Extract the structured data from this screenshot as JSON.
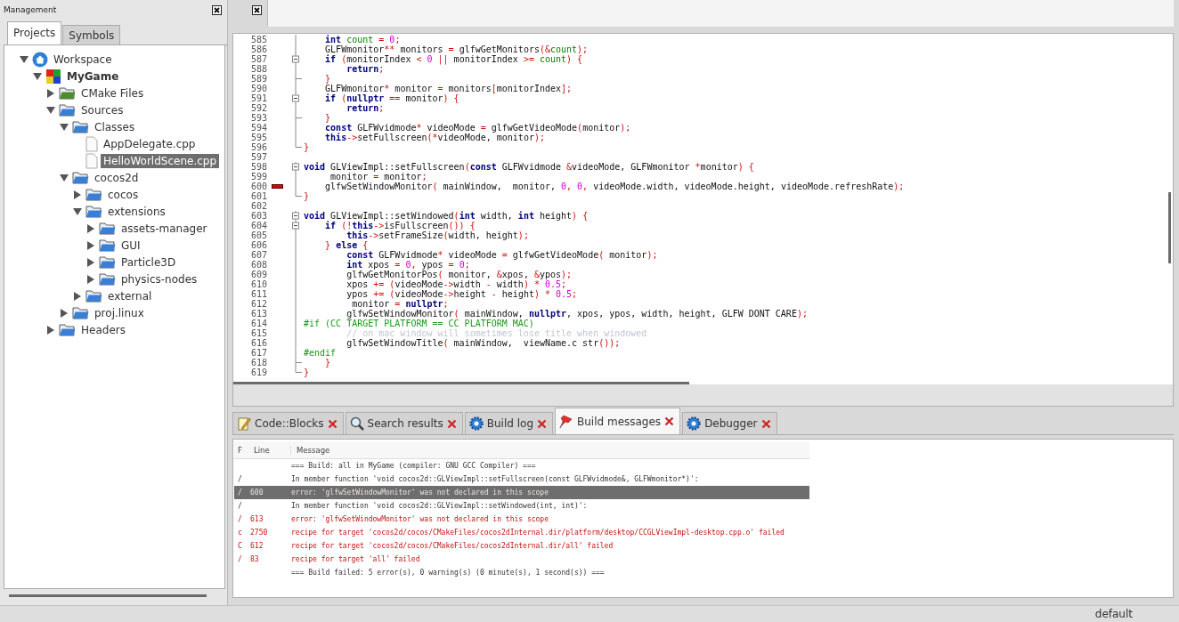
{
  "management": {
    "title": "Management",
    "tabs": [
      {
        "label": "Projects",
        "selected": true
      },
      {
        "label": "Symbols",
        "selected": false
      }
    ],
    "tree": [
      {
        "label": "Workspace",
        "kind": "workspace",
        "expanded": true,
        "selected": false,
        "children": [
          {
            "label": "MyGame",
            "kind": "project",
            "expanded": true,
            "selected": false,
            "children": [
              {
                "label": "CMake Files",
                "kind": "folder",
                "color": "#4e8a2e",
                "expanded": false,
                "selected": false
              },
              {
                "label": "Sources",
                "kind": "folder",
                "color": "#3a7fd6",
                "expanded": true,
                "selected": false,
                "children": [
                  {
                    "label": "Classes",
                    "kind": "folder",
                    "color": "#3a7fd6",
                    "expanded": true,
                    "selected": false,
                    "children": [
                      {
                        "label": "AppDelegate.cpp",
                        "kind": "file",
                        "selected": false
                      },
                      {
                        "label": "HelloWorldScene.cpp",
                        "kind": "file",
                        "selected": true
                      }
                    ]
                  },
                  {
                    "label": "cocos2d",
                    "kind": "folder",
                    "color": "#3a7fd6",
                    "expanded": true,
                    "selected": false,
                    "children": [
                      {
                        "label": "cocos",
                        "kind": "folder",
                        "color": "#3a7fd6",
                        "expanded": false,
                        "selected": false
                      },
                      {
                        "label": "extensions",
                        "kind": "folder",
                        "color": "#3a7fd6",
                        "expanded": true,
                        "selected": false,
                        "children": [
                          {
                            "label": "assets-manager",
                            "kind": "folder",
                            "color": "#3a7fd6",
                            "expanded": false,
                            "selected": false
                          },
                          {
                            "label": "GUI",
                            "kind": "folder",
                            "color": "#3a7fd6",
                            "expanded": false,
                            "selected": false
                          },
                          {
                            "label": "Particle3D",
                            "kind": "folder",
                            "color": "#3a7fd6",
                            "expanded": false,
                            "selected": false
                          },
                          {
                            "label": "physics-nodes",
                            "kind": "folder",
                            "color": "#3a7fd6",
                            "expanded": false,
                            "selected": false
                          }
                        ]
                      },
                      {
                        "label": "external",
                        "kind": "folder",
                        "color": "#3a7fd6",
                        "expanded": false,
                        "selected": false
                      }
                    ]
                  },
                  {
                    "label": "proj.linux",
                    "kind": "folder",
                    "color": "#3a7fd6",
                    "expanded": false,
                    "selected": false
                  }
                ]
              },
              {
                "label": "Headers",
                "kind": "folder",
                "color": "#3a7fd6",
                "expanded": false,
                "selected": false
              }
            ]
          }
        ]
      }
    ]
  },
  "editor": {
    "lines": [
      {
        "number": "585",
        "kind": "line",
        "error": false,
        "tokens": [
          {
            "kind": "kw",
            "text": "    int"
          },
          {
            "kind": "var",
            "text": " count"
          },
          {
            "kind": "op",
            "text": " ="
          },
          {
            "kind": "num",
            "text": " 0"
          },
          {
            "kind": "op",
            "text": ";"
          }
        ]
      },
      {
        "number": "586",
        "kind": "line",
        "error": false,
        "tokens": [
          {
            "kind": "tx",
            "text": "    GLFWmonitor"
          },
          {
            "kind": "op",
            "text": "**"
          },
          {
            "kind": "tx",
            "text": " monitors "
          },
          {
            "kind": "op",
            "text": "="
          },
          {
            "kind": "tx",
            "text": " glfwGetMonitors"
          },
          {
            "kind": "op",
            "text": "(&"
          },
          {
            "kind": "var",
            "text": "count"
          },
          {
            "kind": "op",
            "text": ");"
          }
        ]
      },
      {
        "number": "587",
        "kind": "open",
        "error": false,
        "tokens": [
          {
            "kind": "kw",
            "text": "    if"
          },
          {
            "kind": "op",
            "text": " ("
          },
          {
            "kind": "tx",
            "text": "monitorIndex "
          },
          {
            "kind": "op",
            "text": "<"
          },
          {
            "kind": "num",
            "text": " 0"
          },
          {
            "kind": "op",
            "text": " ||"
          },
          {
            "kind": "tx",
            "text": " monitorIndex "
          },
          {
            "kind": "op",
            "text": ">="
          },
          {
            "kind": "var",
            "text": " count"
          },
          {
            "kind": "op",
            "text": ") {"
          }
        ]
      },
      {
        "number": "588",
        "kind": "line",
        "error": false,
        "tokens": [
          {
            "kind": "kw",
            "text": "        return"
          },
          {
            "kind": "op",
            "text": ";"
          }
        ]
      },
      {
        "number": "589",
        "kind": "branch",
        "error": false,
        "tokens": [
          {
            "kind": "op",
            "text": "    }"
          }
        ]
      },
      {
        "number": "590",
        "kind": "line",
        "error": false,
        "tokens": [
          {
            "kind": "tx",
            "text": "    GLFWmonitor"
          },
          {
            "kind": "op",
            "text": "*"
          },
          {
            "kind": "tx",
            "text": " monitor "
          },
          {
            "kind": "op",
            "text": "="
          },
          {
            "kind": "tx",
            "text": " monitors"
          },
          {
            "kind": "op",
            "text": "["
          },
          {
            "kind": "tx",
            "text": "monitorIndex"
          },
          {
            "kind": "op",
            "text": "];"
          }
        ]
      },
      {
        "number": "591",
        "kind": "open",
        "error": false,
        "tokens": [
          {
            "kind": "kw",
            "text": "    if"
          },
          {
            "kind": "op",
            "text": " ("
          },
          {
            "kind": "kw",
            "text": "nullptr"
          },
          {
            "kind": "op",
            "text": " =="
          },
          {
            "kind": "tx",
            "text": " monitor"
          },
          {
            "kind": "op",
            "text": ") {"
          }
        ]
      },
      {
        "number": "592",
        "kind": "line",
        "error": false,
        "tokens": [
          {
            "kind": "kw",
            "text": "        return"
          },
          {
            "kind": "op",
            "text": ";"
          }
        ]
      },
      {
        "number": "593",
        "kind": "branch",
        "error": false,
        "tokens": [
          {
            "kind": "op",
            "text": "    }"
          }
        ]
      },
      {
        "number": "594",
        "kind": "line",
        "error": false,
        "tokens": [
          {
            "kind": "kw",
            "text": "    const"
          },
          {
            "kind": "tx",
            "text": " GLFWvidmode"
          },
          {
            "kind": "op",
            "text": "*"
          },
          {
            "kind": "tx",
            "text": " videoMode "
          },
          {
            "kind": "op",
            "text": "="
          },
          {
            "kind": "tx",
            "text": " glfwGetVideoMode"
          },
          {
            "kind": "op",
            "text": "("
          },
          {
            "kind": "tx",
            "text": "monitor"
          },
          {
            "kind": "op",
            "text": ");"
          }
        ]
      },
      {
        "number": "595",
        "kind": "line",
        "error": false,
        "tokens": [
          {
            "kind": "kw",
            "text": "    this"
          },
          {
            "kind": "op",
            "text": "->"
          },
          {
            "kind": "tx",
            "text": "setFullscreen"
          },
          {
            "kind": "op",
            "text": "(*"
          },
          {
            "kind": "tx",
            "text": "videoMode, monitor"
          },
          {
            "kind": "op",
            "text": ");"
          }
        ]
      },
      {
        "number": "596",
        "kind": "end",
        "error": false,
        "tokens": [
          {
            "kind": "op",
            "text": "}"
          }
        ]
      },
      {
        "number": "597",
        "kind": "plain",
        "error": false
      },
      {
        "number": "598",
        "kind": "open",
        "error": false,
        "tokens": [
          {
            "kind": "kw",
            "text": "void"
          },
          {
            "kind": "tx",
            "text": " GLViewImpl::setFullscreen"
          },
          {
            "kind": "op",
            "text": "("
          },
          {
            "kind": "kw",
            "text": "const"
          },
          {
            "kind": "tx",
            "text": " GLFWvidmode "
          },
          {
            "kind": "op",
            "text": "&"
          },
          {
            "kind": "tx",
            "text": "videoMode, GLFWmonitor "
          },
          {
            "kind": "op",
            "text": "*"
          },
          {
            "kind": "tx",
            "text": "monitor"
          },
          {
            "kind": "op",
            "text": ") {"
          }
        ]
      },
      {
        "number": "599",
        "kind": "line",
        "error": false,
        "tokens": [
          {
            "kind": "tx",
            "text": "     monitor "
          },
          {
            "kind": "op",
            "text": "="
          },
          {
            "kind": "tx",
            "text": " monitor"
          },
          {
            "kind": "op",
            "text": ";"
          }
        ]
      },
      {
        "number": "600",
        "kind": "line",
        "error": true,
        "tokens": [
          {
            "kind": "tx",
            "text": "    glfwSetWindowMonitor"
          },
          {
            "kind": "op",
            "text": "("
          },
          {
            "kind": "tx",
            "text": " mainWindow,  monitor,"
          },
          {
            "kind": "num",
            "text": " 0"
          },
          {
            "kind": "op",
            "text": ","
          },
          {
            "kind": "num",
            "text": " 0"
          },
          {
            "kind": "op",
            "text": ","
          },
          {
            "kind": "tx",
            "text": " videoMode.width, videoMode.height, videoMode.refreshRate"
          },
          {
            "kind": "op",
            "text": ");"
          }
        ]
      },
      {
        "number": "601",
        "kind": "end",
        "error": false,
        "tokens": [
          {
            "kind": "op",
            "text": "}"
          }
        ]
      },
      {
        "number": "602",
        "kind": "plain",
        "error": false
      },
      {
        "number": "603",
        "kind": "open",
        "error": false,
        "tokens": [
          {
            "kind": "kw",
            "text": "void"
          },
          {
            "kind": "tx",
            "text": " GLViewImpl::setWindowed"
          },
          {
            "kind": "op",
            "text": "("
          },
          {
            "kind": "kw",
            "text": "int"
          },
          {
            "kind": "tx",
            "text": " width,"
          },
          {
            "kind": "kw",
            "text": " int"
          },
          {
            "kind": "tx",
            "text": " height"
          },
          {
            "kind": "op",
            "text": ") {"
          }
        ]
      },
      {
        "number": "604",
        "kind": "open",
        "error": false,
        "tokens": [
          {
            "kind": "kw",
            "text": "    if"
          },
          {
            "kind": "op",
            "text": " (!"
          },
          {
            "kind": "kw",
            "text": "this"
          },
          {
            "kind": "op",
            "text": "->"
          },
          {
            "kind": "tx",
            "text": "isFullscreen"
          },
          {
            "kind": "op",
            "text": "()) {"
          }
        ]
      },
      {
        "number": "605",
        "kind": "line",
        "error": false,
        "tokens": [
          {
            "kind": "kw",
            "text": "        this"
          },
          {
            "kind": "op",
            "text": "->"
          },
          {
            "kind": "tx",
            "text": "setFrameSize"
          },
          {
            "kind": "op",
            "text": "("
          },
          {
            "kind": "tx",
            "text": "width, height"
          },
          {
            "kind": "op",
            "text": ");"
          }
        ]
      },
      {
        "number": "606",
        "kind": "line",
        "error": false,
        "tokens": [
          {
            "kind": "op",
            "text": "    }"
          },
          {
            "kind": "kw",
            "text": " else"
          },
          {
            "kind": "op",
            "text": " {"
          }
        ]
      },
      {
        "number": "607",
        "kind": "line",
        "error": false,
        "tokens": [
          {
            "kind": "kw",
            "text": "        const"
          },
          {
            "kind": "tx",
            "text": " GLFWvidmode"
          },
          {
            "kind": "op",
            "text": "*"
          },
          {
            "kind": "tx",
            "text": " videoMode "
          },
          {
            "kind": "op",
            "text": "="
          },
          {
            "kind": "tx",
            "text": " glfwGetVideoMode"
          },
          {
            "kind": "op",
            "text": "("
          },
          {
            "kind": "tx",
            "text": " monitor"
          },
          {
            "kind": "op",
            "text": ");"
          }
        ]
      },
      {
        "number": "608",
        "kind": "line",
        "error": false,
        "tokens": [
          {
            "kind": "kw",
            "text": "        int"
          },
          {
            "kind": "tx",
            "text": " xpos "
          },
          {
            "kind": "op",
            "text": "="
          },
          {
            "kind": "num",
            "text": " 0"
          },
          {
            "kind": "op",
            "text": ","
          },
          {
            "kind": "tx",
            "text": " ypos "
          },
          {
            "kind": "op",
            "text": "="
          },
          {
            "kind": "num",
            "text": " 0"
          },
          {
            "kind": "op",
            "text": ";"
          }
        ]
      },
      {
        "number": "609",
        "kind": "line",
        "error": false,
        "tokens": [
          {
            "kind": "tx",
            "text": "        glfwGetMonitorPos"
          },
          {
            "kind": "op",
            "text": "("
          },
          {
            "kind": "tx",
            "text": " monitor, "
          },
          {
            "kind": "op",
            "text": "&"
          },
          {
            "kind": "tx",
            "text": "xpos, "
          },
          {
            "kind": "op",
            "text": "&"
          },
          {
            "kind": "tx",
            "text": "ypos"
          },
          {
            "kind": "op",
            "text": ");"
          }
        ]
      },
      {
        "number": "610",
        "kind": "line",
        "error": false,
        "tokens": [
          {
            "kind": "tx",
            "text": "        xpos "
          },
          {
            "kind": "op",
            "text": "+= ("
          },
          {
            "kind": "tx",
            "text": "videoMode"
          },
          {
            "kind": "op",
            "text": "->"
          },
          {
            "kind": "tx",
            "text": "width "
          },
          {
            "kind": "op",
            "text": "-"
          },
          {
            "kind": "tx",
            "text": " width"
          },
          {
            "kind": "op",
            "text": ") *"
          },
          {
            "kind": "num",
            "text": " 0.5"
          },
          {
            "kind": "op",
            "text": ";"
          }
        ]
      },
      {
        "number": "611",
        "kind": "line",
        "error": false,
        "tokens": [
          {
            "kind": "tx",
            "text": "        ypos "
          },
          {
            "kind": "op",
            "text": "+= ("
          },
          {
            "kind": "tx",
            "text": "videoMode"
          },
          {
            "kind": "op",
            "text": "->"
          },
          {
            "kind": "tx",
            "text": "height "
          },
          {
            "kind": "op",
            "text": "-"
          },
          {
            "kind": "tx",
            "text": " height"
          },
          {
            "kind": "op",
            "text": ") *"
          },
          {
            "kind": "num",
            "text": " 0.5"
          },
          {
            "kind": "op",
            "text": ";"
          }
        ]
      },
      {
        "number": "612",
        "kind": "line",
        "error": false,
        "tokens": [
          {
            "kind": "tx",
            "text": "         monitor "
          },
          {
            "kind": "op",
            "text": "="
          },
          {
            "kind": "kw",
            "text": " nullptr"
          },
          {
            "kind": "op",
            "text": ";"
          }
        ]
      },
      {
        "number": "613",
        "kind": "line",
        "error": false,
        "tokens": [
          {
            "kind": "tx",
            "text": "        glfwSetWindowMonitor"
          },
          {
            "kind": "op",
            "text": "("
          },
          {
            "kind": "tx",
            "text": " mainWindow,"
          },
          {
            "kind": "kw",
            "text": " nullptr"
          },
          {
            "kind": "tx",
            "text": ", xpos, ypos, width, height, GLFW DONT CARE"
          },
          {
            "kind": "op",
            "text": ");"
          }
        ]
      },
      {
        "number": "614",
        "kind": "line",
        "error": false,
        "tokens": [
          {
            "kind": "pp",
            "text": "#if (CC TARGET PLATFORM == CC PLATFORM MAC)"
          }
        ]
      },
      {
        "number": "615",
        "kind": "line",
        "error": false,
        "tokens": [
          {
            "kind": "cm",
            "text": "        // on mac window will sometimes lose title when windowed"
          }
        ]
      },
      {
        "number": "616",
        "kind": "line",
        "error": false,
        "tokens": [
          {
            "kind": "tx",
            "text": "        glfwSetWindowTitle"
          },
          {
            "kind": "op",
            "text": "("
          },
          {
            "kind": "tx",
            "text": " mainWindow,  viewName.c str"
          },
          {
            "kind": "op",
            "text": "());"
          }
        ]
      },
      {
        "number": "617",
        "kind": "line",
        "error": false,
        "tokens": [
          {
            "kind": "pp",
            "text": "#endif"
          }
        ]
      },
      {
        "number": "618",
        "kind": "branch",
        "error": false,
        "tokens": [
          {
            "kind": "op",
            "text": "    }"
          }
        ]
      },
      {
        "number": "619",
        "kind": "end",
        "error": false,
        "tokens": [
          {
            "kind": "op",
            "text": "}"
          }
        ]
      }
    ]
  },
  "log_tabs": [
    {
      "label": "Code::Blocks",
      "kind": "note",
      "selected": false
    },
    {
      "label": "Search results",
      "kind": "search",
      "selected": false
    },
    {
      "label": "Build log",
      "kind": "gear",
      "selected": false
    },
    {
      "label": "Build messages",
      "kind": "pin",
      "selected": true
    },
    {
      "label": "Debugger",
      "kind": "gear",
      "selected": false
    }
  ],
  "build_messages": {
    "columns": [
      {
        "label": "F"
      },
      {
        "label": "Line"
      },
      {
        "label": "Message"
      }
    ],
    "rows": [
      {
        "file": "",
        "line": "",
        "message": "=== Build: all in MyGame (compiler: GNU GCC Compiler) ===",
        "kind": "info",
        "selected": false
      },
      {
        "file": "/",
        "line": "",
        "message": "In member function 'void cocos2d::GLViewImpl::setFullscreen(const GLFWvidmode&, GLFWmonitor*)':",
        "kind": "info",
        "selected": false
      },
      {
        "file": "/",
        "line": "600",
        "message": "error: 'glfwSetWindowMonitor' was not declared in this scope",
        "kind": "error",
        "selected": true
      },
      {
        "file": "/",
        "line": "",
        "message": "In member function 'void cocos2d::GLViewImpl::setWindowed(int, int)':",
        "kind": "info",
        "selected": false
      },
      {
        "file": "/",
        "line": "613",
        "message": "error: 'glfwSetWindowMonitor' was not declared in this scope",
        "kind": "error",
        "selected": false
      },
      {
        "file": "c",
        "line": "2750",
        "message": "recipe for target 'cocos2d/cocos/CMakeFiles/cocos2dInternal.dir/platform/desktop/CCGLViewImpl-desktop.cpp.o' failed",
        "kind": "error",
        "selected": false
      },
      {
        "file": "C",
        "line": "612",
        "message": "recipe for target 'cocos2d/cocos/CMakeFiles/cocos2dInternal.dir/all' failed",
        "kind": "error",
        "selected": false
      },
      {
        "file": "/",
        "line": "83",
        "message": "recipe for target 'all' failed",
        "kind": "error",
        "selected": false
      },
      {
        "file": "",
        "line": "",
        "message": "=== Build failed: 5 error(s), 0 warning(s) (0 minute(s), 1 second(s)) ===",
        "kind": "info",
        "selected": false
      }
    ]
  },
  "status_bar": {
    "text": "default"
  }
}
